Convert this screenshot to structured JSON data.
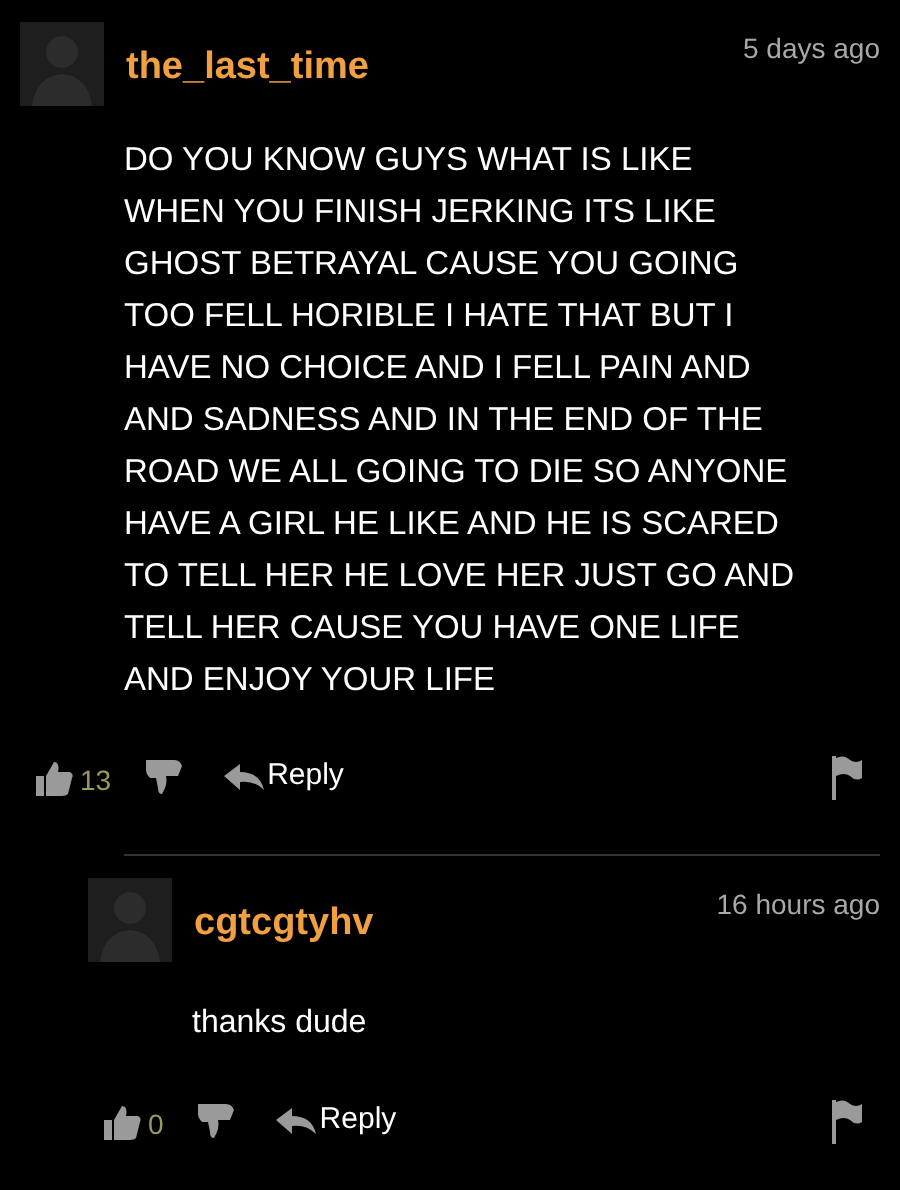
{
  "comments": [
    {
      "username": "the_last_time",
      "time": "5 days ago",
      "body": "DO YOU KNOW GUYS WHAT IS LIKE WHEN YOU FINISH JERKING ITS LIKE GHOST BETRAYAL CAUSE YOU GOING TOO FELL HORIBLE I HATE THAT BUT I HAVE NO CHOICE AND I FELL PAIN AND AND SADNESS AND IN THE END OF THE ROAD WE ALL GOING TO DIE SO ANYONE HAVE A GIRL HE LIKE AND HE IS SCARED TO TELL HER HE LOVE HER JUST GO AND TELL HER CAUSE YOU HAVE ONE LIFE AND ENJOY YOUR LIFE",
      "likes": "13",
      "reply_label": "Reply",
      "replies": [
        {
          "username": "cgtcgtyhv",
          "time": "16 hours ago",
          "body": "thanks dude",
          "likes": "0",
          "reply_label": "Reply"
        }
      ]
    }
  ]
}
